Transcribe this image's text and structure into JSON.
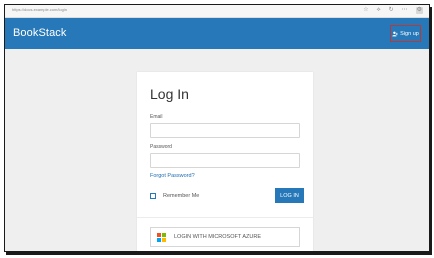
{
  "browser": {
    "url": "https://docs.example.com/login",
    "icons": [
      "star-icon",
      "extension-icon",
      "refresh-icon",
      "menu-icon",
      "settings-icon"
    ]
  },
  "header": {
    "logo": "BookStack",
    "signup_label": "Sign up",
    "colors": {
      "brand": "#2778b8",
      "signup_border": "#b53a3a"
    }
  },
  "login": {
    "title": "Log In",
    "email_label": "Email",
    "email_value": "",
    "password_label": "Password",
    "password_value": "",
    "forgot_link": "Forgot Password?",
    "remember_label": "Remember Me",
    "remember_checked": false,
    "submit_label": "LOG IN",
    "azure_label": "LOGIN WITH MICROSOFT AZURE"
  }
}
